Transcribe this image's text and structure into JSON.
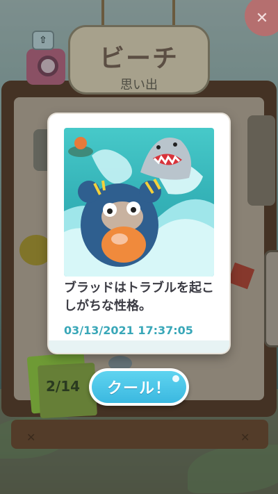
{
  "top_bar": {
    "close_label": "✕",
    "share_label": "⇧"
  },
  "sign": {
    "title": "ビーチ",
    "subtitle": "思い出"
  },
  "memory_card": {
    "caption": "ブラッドはトラブルを起こしがちな性格。",
    "timestamp": "03/13/2021 17:37:05"
  },
  "page_counter": "2/14",
  "action_button": {
    "label": "クール！"
  },
  "colors": {
    "accent": "#3bb8e0",
    "timestamp": "#39a7b8",
    "caption": "#3c3c44",
    "sea": "#35b3b8"
  },
  "icons": {
    "close": "close-icon",
    "share": "share-icon",
    "camera": "camera-icon"
  }
}
